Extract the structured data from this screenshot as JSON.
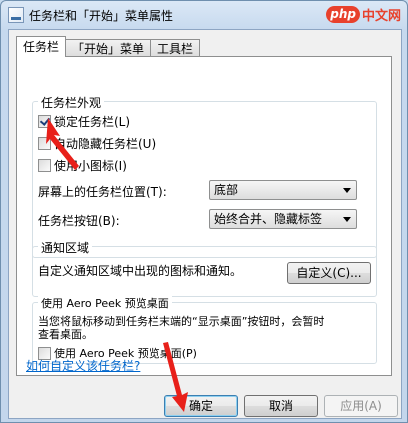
{
  "window": {
    "title": "任务栏和「开始」菜单属性"
  },
  "brand": {
    "logo": "php",
    "name": "中文网"
  },
  "tabs": [
    {
      "label": "任务栏"
    },
    {
      "label": "「开始」菜单"
    },
    {
      "label": "工具栏"
    }
  ],
  "appearance": {
    "title": "任务栏外观",
    "lock_taskbar": {
      "label": "锁定任务栏(L)",
      "checked": true
    },
    "auto_hide": {
      "label": "自动隐藏任务栏(U)",
      "checked": false
    },
    "small_icons": {
      "label": "使用小图标(I)",
      "checked": false
    },
    "location_label": "屏幕上的任务栏位置(T):",
    "location_value": "底部",
    "buttons_label": "任务栏按钮(B):",
    "buttons_value": "始终合并、隐藏标签"
  },
  "notification": {
    "title": "通知区域",
    "description": "自定义通知区域中出现的图标和通知。",
    "customize_button": "自定义(C)..."
  },
  "aero_peek": {
    "title": "使用 Aero Peek 预览桌面",
    "description_line1": "当您将鼠标移动到任务栏末端的“显示桌面”按钮时，会暂时",
    "description_line2": "查看桌面。",
    "checkbox_label": "使用 Aero Peek 预览桌面(P)",
    "checked": false
  },
  "help_link": "如何自定义该任务栏?",
  "buttons": {
    "ok": "确定",
    "cancel": "取消",
    "apply": "应用(A)"
  },
  "colors": {
    "annotation_arrow": "#e8201a",
    "link": "#0066cc"
  }
}
